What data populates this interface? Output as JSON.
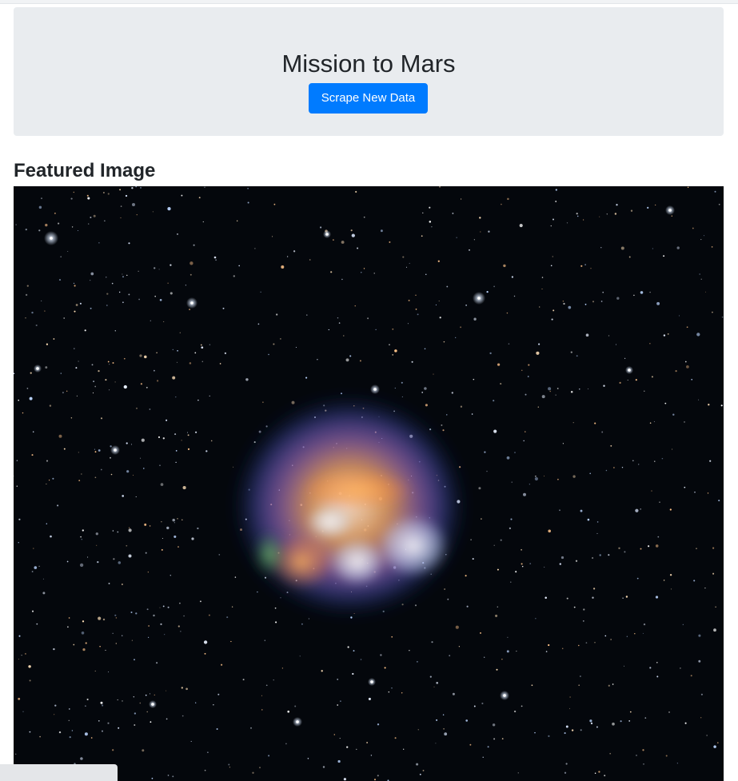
{
  "header": {
    "title": "Mission to Mars",
    "scrape_button_label": "Scrape New Data"
  },
  "featured": {
    "section_title": "Featured Image"
  },
  "colors": {
    "jumbotron_bg": "#e9ecef",
    "button_primary": "#007bff",
    "image_background": "#04070c"
  }
}
